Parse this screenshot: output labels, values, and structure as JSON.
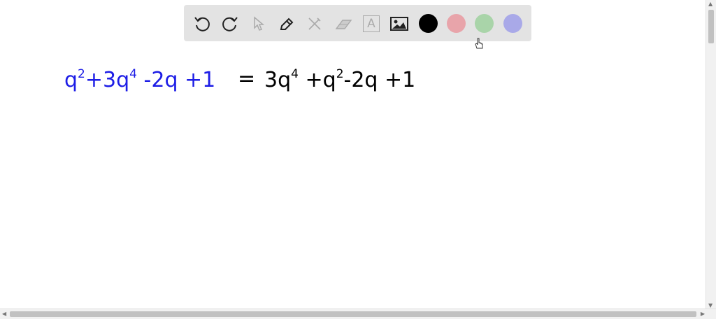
{
  "toolbar": {
    "tools": [
      "undo-icon",
      "redo-icon",
      "select-icon",
      "pen-icon",
      "tools-icon",
      "eraser-icon",
      "text-icon",
      "image-icon"
    ],
    "text_tool_glyph": "A",
    "colors": {
      "black": "#000000",
      "red": "#e8a4aa",
      "green": "#a9d4a9",
      "blue": "#a9a9e8"
    }
  },
  "canvas": {
    "left_expr": {
      "t1": "q",
      "e1": "2",
      "t2": "+3q",
      "e2": "4",
      "t3": "-2q +1"
    },
    "equals": "=",
    "right_expr": {
      "t1": "3q",
      "e1": "4",
      "t2": " +q",
      "e2": "2",
      "t3": "-2q +1"
    },
    "ink_colors": {
      "left": "#1d1de6",
      "right": "#000000"
    }
  }
}
